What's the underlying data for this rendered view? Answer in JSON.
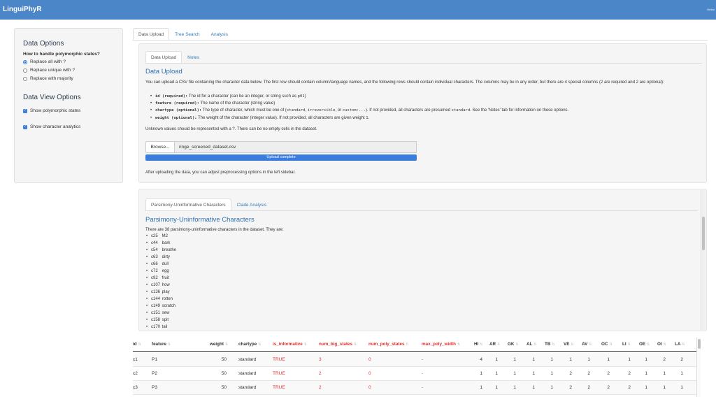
{
  "navbar": {
    "brand": "LinguiPhyR",
    "right_text": "Versio"
  },
  "sidebar": {
    "data_options_title": "Data Options",
    "poly_question": "How to handle polymorphic states?",
    "poly_options": [
      "Replace all with ?",
      "Replace unique with ?",
      "Replace with majority"
    ],
    "poly_selected": 0,
    "view_options_title": "Data View Options",
    "checkboxes": [
      {
        "label": "Show polymorphic states",
        "checked": true
      },
      {
        "label": "Show character analytics",
        "checked": true
      }
    ]
  },
  "main_tabs": [
    "Data Upload",
    "Tree Search",
    "Analysis"
  ],
  "upload_tabs": [
    "Data Upload",
    "Notes"
  ],
  "upload": {
    "title": "Data Upload",
    "intro": "You can upload a CSV file containing the character data below. The first row should contain column/language names, and the following rows should contain individual characters. The columns may be in any order, but there are 4 special columns (2 are required and 2 are optional):",
    "b1_key": "id (required):",
    "b1_text": " The id for a character (can be an integer, or string such as ",
    "b1_code": "p01",
    "b1_end": ")",
    "b2_key": "feature (required):",
    "b2_text": " The name of the character (string value)",
    "b3_key": "chartype (optional):",
    "b3_text": " The type of character, which must be one of (",
    "b3_c1": "standard",
    "b3_sep1": ", ",
    "b3_c2": "irreversible",
    "b3_sep2": ", or ",
    "b3_c3": "custom:...",
    "b3_text2": "). If not provided, all characters are presumed ",
    "b3_c4": "standard",
    "b3_text3": ". See the 'Notes' tab for information on these options.",
    "b4_key": "weight (optional):",
    "b4_text": " The weight of the character (integer value). If not provided, all characters are given weight ",
    "b4_code": "1",
    "b4_end": ".",
    "unknown_text": "Unknown values should be represented with a ?. There can be no empty cells in the dataset.",
    "browse_label": "Browse...",
    "filename": "ringe_screened_dataset.csv",
    "progress_label": "Upload complete",
    "progress_fraction": 1.0,
    "after_text": "After uploading the data, you can adjust preprocessing options in the left sidebar."
  },
  "analysis_tabs": [
    "Parsimony-Uninformative Characters",
    "Clade Analysis"
  ],
  "analysis": {
    "title": "Parsimony-Uninformative Characters",
    "intro": "There are 38 parsimony-uninformative characters in the dataset. They are:",
    "items": [
      {
        "id": "c25",
        "name": "M2"
      },
      {
        "id": "c44",
        "name": "bark"
      },
      {
        "id": "c54",
        "name": "breathe"
      },
      {
        "id": "c63",
        "name": "dirty"
      },
      {
        "id": "c66",
        "name": "dull"
      },
      {
        "id": "c72",
        "name": "egg"
      },
      {
        "id": "c92",
        "name": "fruit"
      },
      {
        "id": "c107",
        "name": "how"
      },
      {
        "id": "c136",
        "name": "play"
      },
      {
        "id": "c144",
        "name": "rotten"
      },
      {
        "id": "c149",
        "name": "scratch"
      },
      {
        "id": "c151",
        "name": "sew"
      },
      {
        "id": "c158",
        "name": "spit"
      },
      {
        "id": "c170",
        "name": "tail"
      }
    ]
  },
  "table": {
    "headers": [
      "id",
      "feature",
      "weight",
      "chartype",
      "is_informative",
      "num_big_states",
      "num_poly_states",
      "max_poly_width",
      "HI",
      "AR",
      "GK",
      "AL",
      "TB",
      "VE",
      "AV",
      "OC",
      "LI",
      "OE",
      "OI",
      "LA"
    ],
    "rows": [
      [
        "c1",
        "P1",
        "50",
        "standard",
        "TRUE",
        "3",
        "0",
        "-",
        "4",
        "1",
        "1",
        "1",
        "1",
        "1",
        "1",
        "1",
        "1",
        "1",
        "2",
        "2"
      ],
      [
        "c2",
        "P2",
        "50",
        "standard",
        "TRUE",
        "2",
        "0",
        "-",
        "1",
        "1",
        "1",
        "1",
        "1",
        "2",
        "2",
        "2",
        "2",
        "1",
        "1",
        "1"
      ],
      [
        "c3",
        "P3",
        "50",
        "standard",
        "TRUE",
        "2",
        "0",
        "-",
        "1",
        "1",
        "1",
        "1",
        "1",
        "2",
        "2",
        "2",
        "2",
        "1",
        "1",
        "1"
      ]
    ]
  },
  "colors": {
    "navbar": "#4a86c8",
    "accent": "#3b7ddd",
    "heading": "#2c6fb0",
    "red": "#e0302b"
  }
}
